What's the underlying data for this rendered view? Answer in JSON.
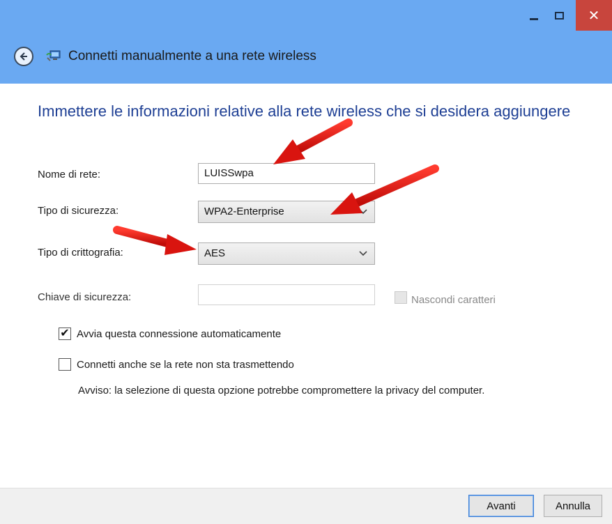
{
  "window": {
    "title": "Connetti manualmente a una rete wireless",
    "controls": {
      "minimize": "",
      "maximize": "",
      "close": "✕"
    }
  },
  "heading": "Immettere le informazioni relative alla rete wireless che si desidera aggiungere",
  "form": {
    "network_name": {
      "label": "Nome di rete:",
      "value": "LUISSwpa"
    },
    "security_type": {
      "label": "Tipo di sicurezza:",
      "value": "WPA2-Enterprise"
    },
    "encryption_type": {
      "label": "Tipo di crittografia:",
      "value": "AES"
    },
    "security_key": {
      "label": "Chiave di sicurezza:",
      "value": ""
    },
    "hide_characters": {
      "label": "Nascondi caratteri",
      "checked": false,
      "enabled": false
    }
  },
  "options": {
    "auto_start": {
      "label": "Avvia questa connessione automaticamente",
      "checked": true
    },
    "connect_hidden": {
      "label": "Connetti anche se la rete non sta trasmettendo",
      "checked": false
    },
    "warning": "Avviso: la selezione di questa opzione potrebbe compromettere la privacy del computer."
  },
  "buttons": {
    "next": "Avanti",
    "cancel": "Annulla"
  },
  "icons": {
    "back": "back-arrow-icon",
    "network": "network-icon",
    "dropdown": "chevron-down-icon",
    "check": "✔",
    "chevron": "⌄"
  },
  "colors": {
    "titlebar": "#6aa9f2",
    "heading": "#1e3f94",
    "close": "#c8453d",
    "annotation": "#e1120f"
  }
}
